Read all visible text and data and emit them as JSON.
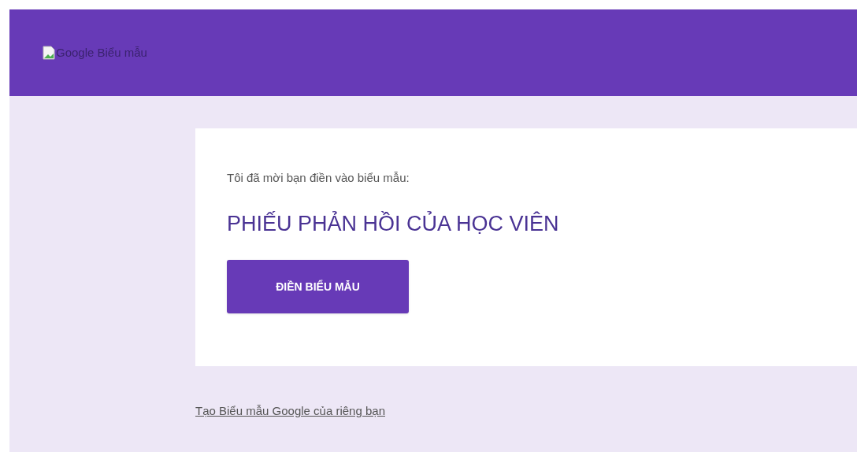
{
  "header": {
    "logo_alt": "Google Biểu mẫu"
  },
  "card": {
    "intro": "Tôi đã mời bạn điền vào biểu mẫu:",
    "form_title": "PHIẾU PHẢN HỒI CỦA HỌC VIÊN",
    "button": "ĐIỀN BIỂU MẪU"
  },
  "footer_link": "Tạo Biểu mẫu Google của riêng bạn"
}
